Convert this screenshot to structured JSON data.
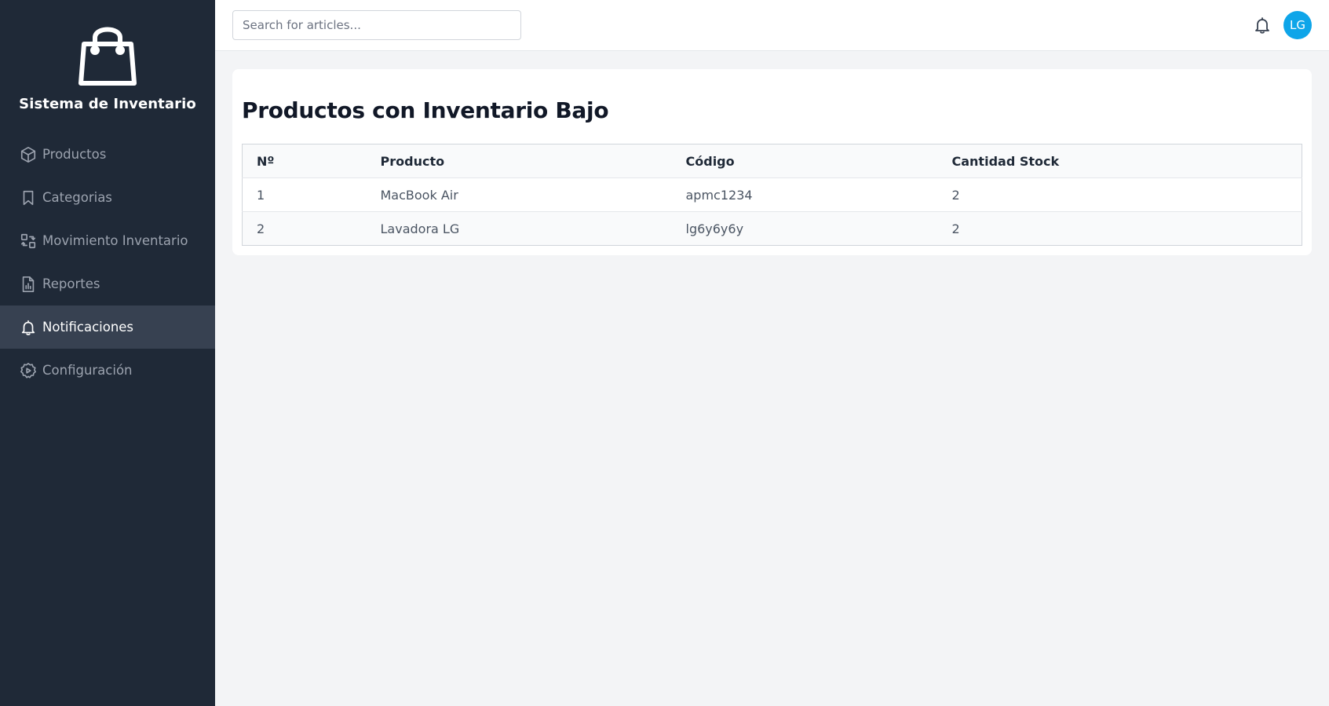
{
  "sidebar": {
    "brand_title": "Sistema de Inventario",
    "items": [
      {
        "label": "Productos",
        "icon": "cube-icon",
        "active": false
      },
      {
        "label": "Categorias",
        "icon": "bookmark-icon",
        "active": false
      },
      {
        "label": "Movimiento Inventario",
        "icon": "transfer-icon",
        "active": false
      },
      {
        "label": "Reportes",
        "icon": "report-icon",
        "active": false
      },
      {
        "label": "Notificaciones",
        "icon": "bell-icon",
        "active": true
      },
      {
        "label": "Configuración",
        "icon": "settings-icon",
        "active": false
      }
    ]
  },
  "topbar": {
    "search_placeholder": "Search for articles...",
    "search_value": "",
    "avatar_initials": "LG"
  },
  "main": {
    "title": "Productos con Inventario Bajo",
    "table": {
      "headers": [
        "Nº",
        "Producto",
        "Código",
        "Cantidad Stock"
      ],
      "rows": [
        [
          "1",
          "MacBook Air",
          "apmc1234",
          "2"
        ],
        [
          "2",
          "Lavadora LG",
          "lg6y6y6y",
          "2"
        ]
      ]
    }
  },
  "colors": {
    "sidebar_bg": "#1f2937",
    "sidebar_active_bg": "#374151",
    "avatar_bg": "#0ea5e9",
    "page_bg": "#f3f4f6"
  }
}
